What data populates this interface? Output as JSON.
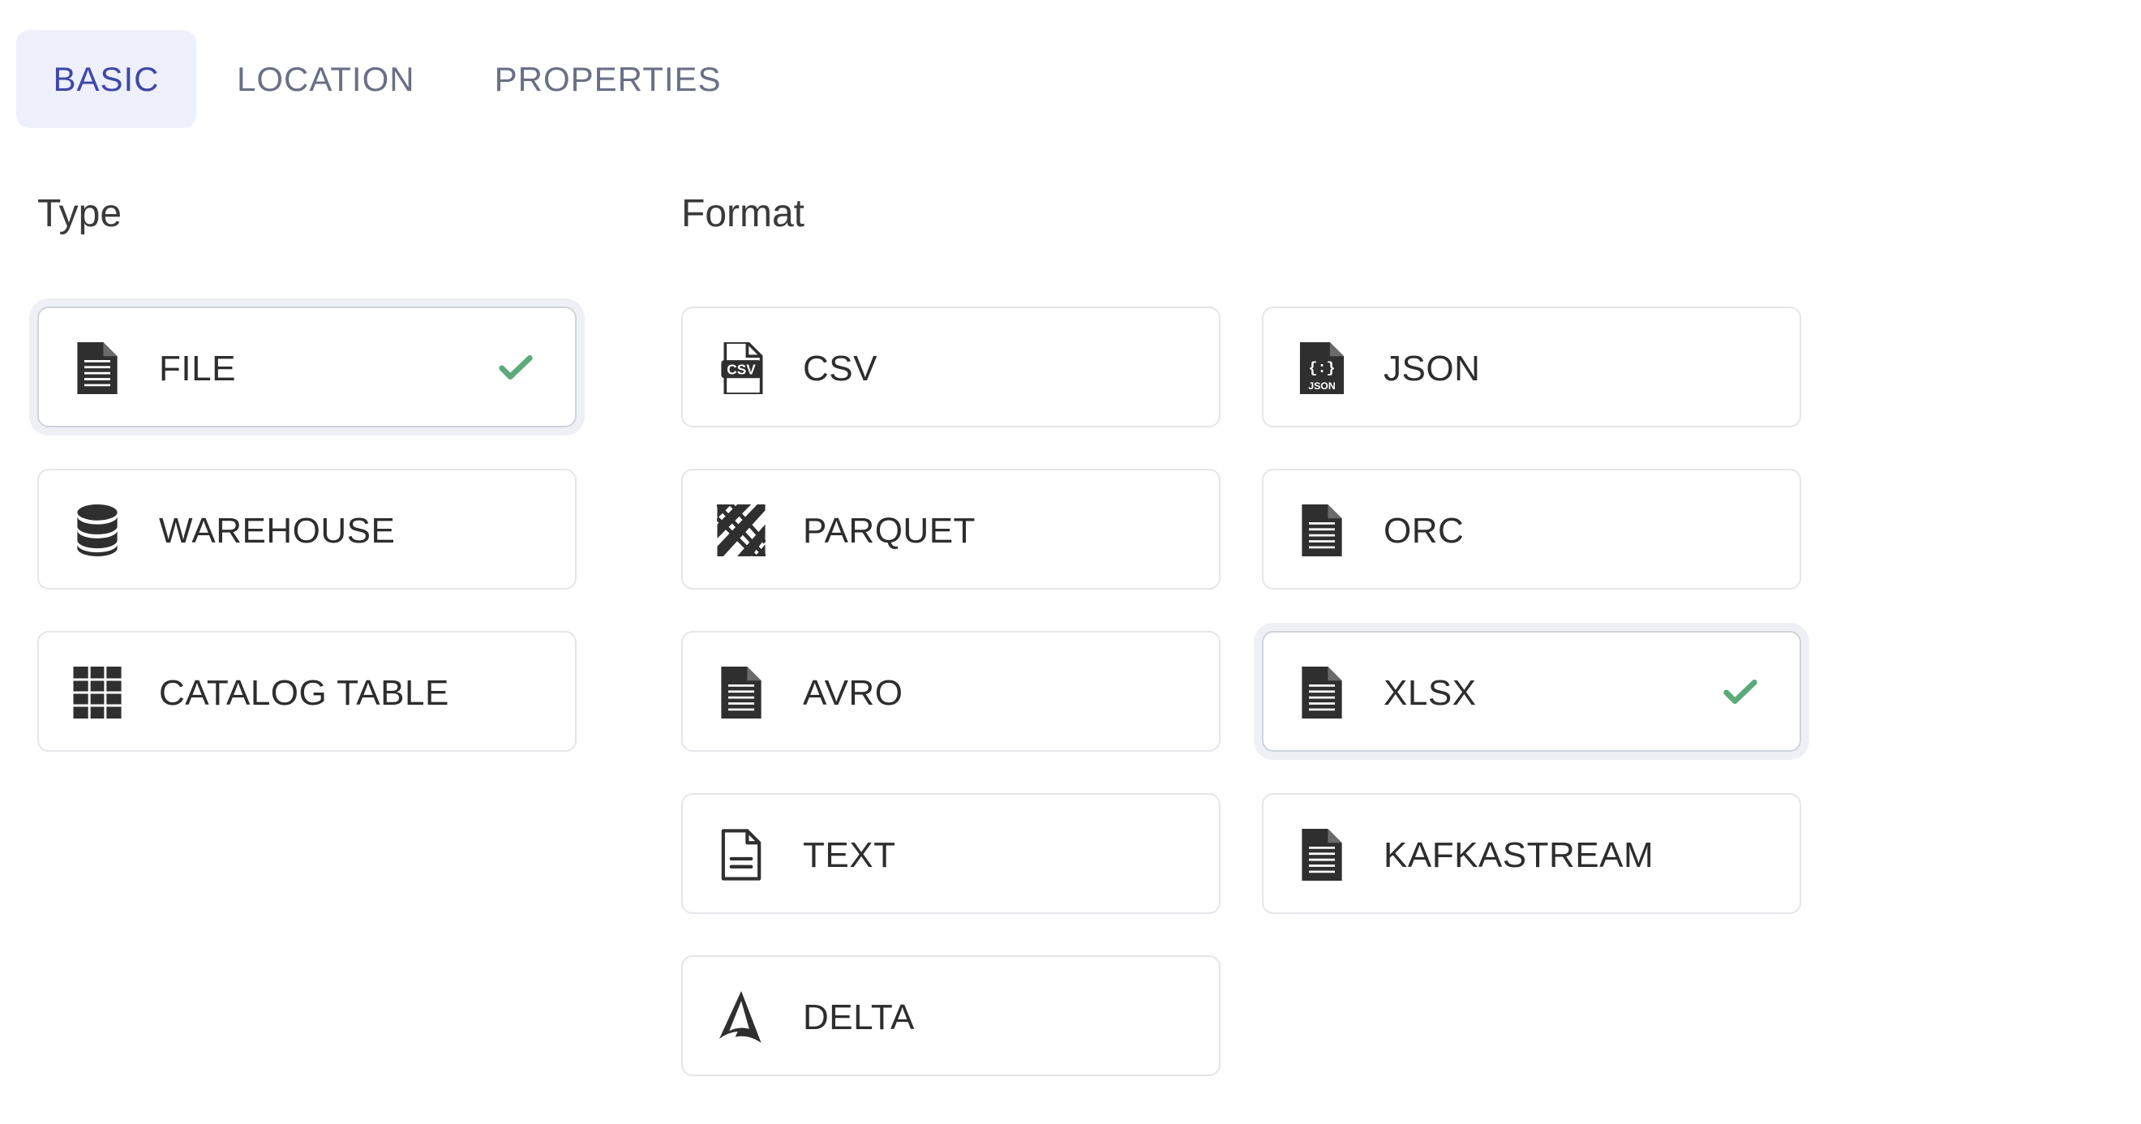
{
  "tabs": [
    {
      "label": "BASIC",
      "active": true
    },
    {
      "label": "LOCATION",
      "active": false
    },
    {
      "label": "PROPERTIES",
      "active": false
    }
  ],
  "type_section": {
    "title": "Type",
    "items": [
      {
        "label": "FILE",
        "icon": "file-lines-icon",
        "selected": true
      },
      {
        "label": "WAREHOUSE",
        "icon": "database-icon",
        "selected": false
      },
      {
        "label": "CATALOG TABLE",
        "icon": "table-grid-icon",
        "selected": false
      }
    ]
  },
  "format_section": {
    "title": "Format",
    "items": [
      {
        "label": "CSV",
        "icon": "csv-file-icon",
        "selected": false
      },
      {
        "label": "JSON",
        "icon": "json-file-icon",
        "selected": false
      },
      {
        "label": "PARQUET",
        "icon": "parquet-icon",
        "selected": false
      },
      {
        "label": "ORC",
        "icon": "file-lines-icon",
        "selected": false
      },
      {
        "label": "AVRO",
        "icon": "file-lines-icon",
        "selected": false
      },
      {
        "label": "XLSX",
        "icon": "file-lines-icon",
        "selected": true
      },
      {
        "label": "TEXT",
        "icon": "file-text-outline-icon",
        "selected": false
      },
      {
        "label": "KAFKASTREAM",
        "icon": "file-lines-icon",
        "selected": false
      },
      {
        "label": "DELTA",
        "icon": "delta-icon",
        "selected": false
      }
    ]
  },
  "colors": {
    "active_tab_bg": "#eef0fb",
    "active_tab_text": "#3f48a8",
    "tab_text": "#6b6f86",
    "check": "#5bab7a",
    "icon": "#2f2f2f"
  }
}
